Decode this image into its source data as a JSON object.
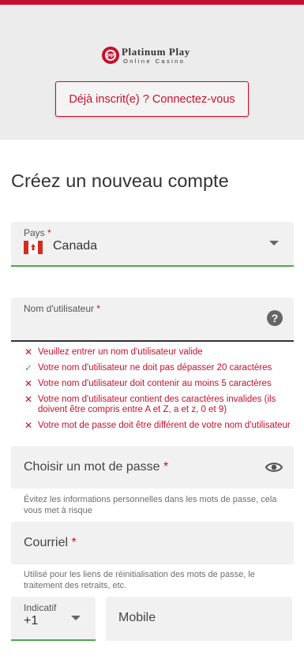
{
  "header": {
    "logo_line1": "Platinum Play",
    "logo_line2": "Online Casino",
    "login_button": "Déjà inscrit(e) ? Connectez-vous"
  },
  "form": {
    "title": "Créez un nouveau compte",
    "country": {
      "label": "Pays",
      "required_mark": "*",
      "value": "Canada",
      "flag_icon": "canada-flag-icon"
    },
    "username": {
      "label": "Nom d'utilisateur",
      "required_mark": "*",
      "help_icon": "?"
    },
    "validation": [
      {
        "status": "error",
        "icon": "✕",
        "text": "Veuillez entrer un nom d'utilisateur valide"
      },
      {
        "status": "ok",
        "icon": "✓",
        "text": "Votre nom d'utilisateur ne doit pas dépasser 20 caractères"
      },
      {
        "status": "error",
        "icon": "✕",
        "text": "Votre nom d'utilisateur doit contenir au moins 5 caractères"
      },
      {
        "status": "error",
        "icon": "✕",
        "text": "Votre nom d'utilisateur contient des caractères invalides (ils doivent être compris entre A et Z, a et z, 0 et 9)"
      },
      {
        "status": "error",
        "icon": "✕",
        "text": "Votre mot de passe doit être différent de votre nom d'utilisateur"
      }
    ],
    "password": {
      "placeholder": "Choisir un mot de passe",
      "required_mark": "*",
      "hint": "Évitez les informations personnelles dans les mots de passe, cela vous met à risque"
    },
    "email": {
      "placeholder": "Courriel",
      "required_mark": "*",
      "hint": "Utilisé pour les liens de réinitialisation des mots de passe, le traitement des retraits, etc."
    },
    "phone": {
      "dial_label": "Indicatif",
      "dial_value": "+1",
      "mobile_placeholder": "Mobile"
    }
  },
  "colors": {
    "brand": "#c8102e",
    "success": "#4aa84a",
    "field_bg": "#f1f1f1"
  }
}
